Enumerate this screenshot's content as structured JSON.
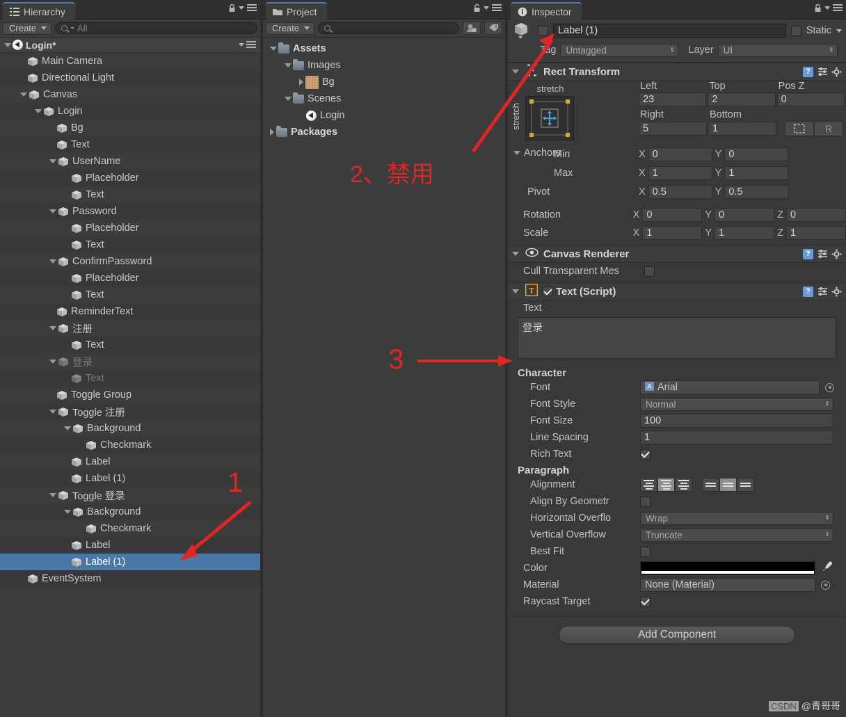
{
  "hierarchy": {
    "tab_label": "Hierarchy",
    "create_label": "Create",
    "search_placeholder": "All",
    "scene_name": "Login*",
    "items": [
      {
        "label": "Main Camera",
        "depth": 1,
        "twist": "none",
        "state": "normal",
        "alt": false
      },
      {
        "label": "Directional Light",
        "depth": 1,
        "twist": "none",
        "state": "normal",
        "alt": true
      },
      {
        "label": "Canvas",
        "depth": 1,
        "twist": "open",
        "state": "normal",
        "alt": false
      },
      {
        "label": "Login",
        "depth": 2,
        "twist": "open",
        "state": "normal",
        "alt": true
      },
      {
        "label": "Bg",
        "depth": 3,
        "twist": "none",
        "state": "normal",
        "alt": false
      },
      {
        "label": "Text",
        "depth": 3,
        "twist": "none",
        "state": "normal",
        "alt": true
      },
      {
        "label": "UserName",
        "depth": 3,
        "twist": "open",
        "state": "normal",
        "alt": false
      },
      {
        "label": "Placeholder",
        "depth": 4,
        "twist": "none",
        "state": "normal",
        "alt": true
      },
      {
        "label": "Text",
        "depth": 4,
        "twist": "none",
        "state": "normal",
        "alt": false
      },
      {
        "label": "Password",
        "depth": 3,
        "twist": "open",
        "state": "normal",
        "alt": true
      },
      {
        "label": "Placeholder",
        "depth": 4,
        "twist": "none",
        "state": "normal",
        "alt": false
      },
      {
        "label": "Text",
        "depth": 4,
        "twist": "none",
        "state": "normal",
        "alt": true
      },
      {
        "label": "ConfirmPassword",
        "depth": 3,
        "twist": "open",
        "state": "normal",
        "alt": false
      },
      {
        "label": "Placeholder",
        "depth": 4,
        "twist": "none",
        "state": "normal",
        "alt": true
      },
      {
        "label": "Text",
        "depth": 4,
        "twist": "none",
        "state": "normal",
        "alt": false
      },
      {
        "label": "ReminderText",
        "depth": 3,
        "twist": "none",
        "state": "normal",
        "alt": true
      },
      {
        "label": "注册",
        "depth": 3,
        "twist": "open",
        "state": "normal",
        "alt": false
      },
      {
        "label": "Text",
        "depth": 4,
        "twist": "none",
        "state": "normal",
        "alt": true
      },
      {
        "label": "登录",
        "depth": 3,
        "twist": "open",
        "state": "disabled",
        "alt": false
      },
      {
        "label": "Text",
        "depth": 4,
        "twist": "none",
        "state": "disabled",
        "alt": true
      },
      {
        "label": "Toggle Group",
        "depth": 3,
        "twist": "none",
        "state": "normal",
        "alt": false
      },
      {
        "label": "Toggle 注册",
        "depth": 3,
        "twist": "open",
        "state": "normal",
        "alt": true
      },
      {
        "label": "Background",
        "depth": 4,
        "twist": "open",
        "state": "normal",
        "alt": false
      },
      {
        "label": "Checkmark",
        "depth": 5,
        "twist": "none",
        "state": "normal",
        "alt": true
      },
      {
        "label": "Label",
        "depth": 4,
        "twist": "none",
        "state": "normal",
        "alt": false
      },
      {
        "label": "Label (1)",
        "depth": 4,
        "twist": "none",
        "state": "normal",
        "alt": true
      },
      {
        "label": "Toggle 登录",
        "depth": 3,
        "twist": "open",
        "state": "normal",
        "alt": false
      },
      {
        "label": "Background",
        "depth": 4,
        "twist": "open",
        "state": "normal",
        "alt": true
      },
      {
        "label": "Checkmark",
        "depth": 5,
        "twist": "none",
        "state": "normal",
        "alt": false
      },
      {
        "label": "Label",
        "depth": 4,
        "twist": "none",
        "state": "normal",
        "alt": true
      },
      {
        "label": "Label (1)",
        "depth": 4,
        "twist": "none",
        "state": "selected",
        "alt": false
      },
      {
        "label": "EventSystem",
        "depth": 1,
        "twist": "none",
        "state": "normal",
        "alt": true
      }
    ]
  },
  "project": {
    "tab_label": "Project",
    "create_label": "Create",
    "search_placeholder": "",
    "items": [
      {
        "label": "Assets",
        "depth": 0,
        "twist": "open",
        "icon": "folder",
        "bold": true
      },
      {
        "label": "Images",
        "depth": 1,
        "twist": "open",
        "icon": "folder",
        "bold": false
      },
      {
        "label": "Bg",
        "depth": 2,
        "twist": "closed",
        "icon": "image",
        "bold": false
      },
      {
        "label": "Scenes",
        "depth": 1,
        "twist": "open",
        "icon": "folder",
        "bold": false
      },
      {
        "label": "Login",
        "depth": 2,
        "twist": "none",
        "icon": "unity",
        "bold": false
      },
      {
        "label": "Packages",
        "depth": 0,
        "twist": "closed",
        "icon": "folder",
        "bold": true
      }
    ]
  },
  "inspector": {
    "tab_label": "Inspector",
    "object_name": "Label (1)",
    "object_enabled": false,
    "static_label": "Static",
    "tag_label": "Tag",
    "tag_value": "Untagged",
    "layer_label": "Layer",
    "layer_value": "UI",
    "rect_transform": {
      "title": "Rect Transform",
      "anchor_preset_top": "stretch",
      "anchor_preset_left": "stretch",
      "fields": {
        "left_label": "Left",
        "left_value": "23",
        "top_label": "Top",
        "top_value": "2",
        "posz_label": "Pos Z",
        "posz_value": "0",
        "right_label": "Right",
        "right_value": "5",
        "bottom_label": "Bottom",
        "bottom_value": "1"
      },
      "anchors_label": "Anchors",
      "min_label": "Min",
      "min_x": "0",
      "min_y": "0",
      "max_label": "Max",
      "max_x": "1",
      "max_y": "1",
      "pivot_label": "Pivot",
      "pivot_x": "0.5",
      "pivot_y": "0.5",
      "rotation_label": "Rotation",
      "rot_x": "0",
      "rot_y": "0",
      "rot_z": "0",
      "scale_label": "Scale",
      "scale_x": "1",
      "scale_y": "1",
      "scale_z": "1",
      "axis_x": "X",
      "axis_y": "Y",
      "axis_z": "Z"
    },
    "canvas_renderer": {
      "title": "Canvas Renderer",
      "cull_label": "Cull Transparent Mes",
      "cull_checked": false
    },
    "text_script": {
      "title": "Text (Script)",
      "enabled": true,
      "text_label": "Text",
      "text_value": "登录",
      "character_label": "Character",
      "font_label": "Font",
      "font_value": "Arial",
      "font_style_label": "Font Style",
      "font_style_value": "Normal",
      "font_size_label": "Font Size",
      "font_size_value": "100",
      "line_spacing_label": "Line Spacing",
      "line_spacing_value": "1",
      "rich_text_label": "Rich Text",
      "rich_text_checked": true,
      "paragraph_label": "Paragraph",
      "alignment_label": "Alignment",
      "alignment_horizontal_selected": 1,
      "alignment_vertical_selected": 1,
      "align_geometry_label": "Align By Geometr",
      "align_geometry_checked": false,
      "h_overflow_label": "Horizontal Overflo",
      "h_overflow_value": "Wrap",
      "v_overflow_label": "Vertical Overflow",
      "v_overflow_value": "Truncate",
      "best_fit_label": "Best Fit",
      "best_fit_checked": false,
      "color_label": "Color",
      "color_value": "#FFFFFF",
      "material_label": "Material",
      "material_value": "None (Material)",
      "raycast_label": "Raycast Target",
      "raycast_checked": true
    },
    "add_component_label": "Add Component"
  },
  "annotations": {
    "note1": "1",
    "note2": "2、禁用",
    "note3": "3",
    "color": "#e02525"
  },
  "watermark": {
    "brand": "CSDN",
    "author": "@青哥哥"
  }
}
